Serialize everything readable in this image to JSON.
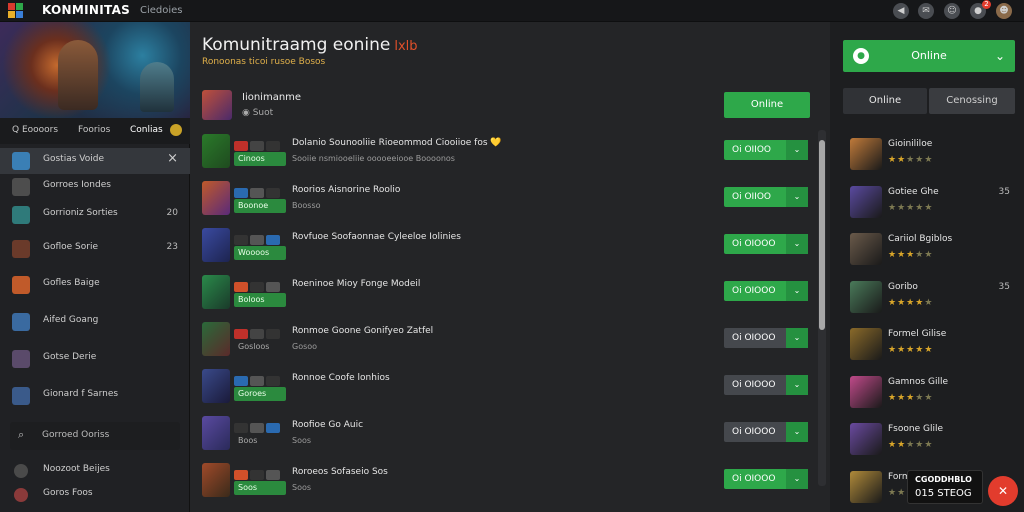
{
  "app": {
    "brand": "KONMINITAS",
    "top_nav": "Ciedoies",
    "top_icons": [
      "back-icon",
      "chat-icon",
      "smile-icon",
      "notification-icon",
      "profile-icon"
    ],
    "notification_count": "2"
  },
  "sidebar": {
    "tabs": [
      {
        "label": "Q Eoooors"
      },
      {
        "label": "Foorios"
      },
      {
        "label": "Conlias"
      }
    ],
    "items": [
      {
        "label": "Gostias Voide",
        "count": "",
        "color": "#3a7fb5",
        "active": true
      },
      {
        "label": "Gorroes Iondes",
        "count": "",
        "color": "#4d4d4d",
        "active": false
      },
      {
        "label": "Gorrioniz Sorties",
        "count": "20",
        "color": "#2f7a7a",
        "active": false
      },
      {
        "label": "Gofloe Sorie",
        "count": "23",
        "color": "#6a3a2a",
        "active": false
      },
      {
        "label": "Gofles Baige",
        "count": "",
        "color": "#c05a2a",
        "active": false
      },
      {
        "label": "Aifed Goang",
        "count": "",
        "color": "#3a6aa0",
        "active": false
      },
      {
        "label": "Gotse Derie",
        "count": "",
        "color": "#5a4a6a",
        "active": false
      },
      {
        "label": "Gionard f Sarnes",
        "count": "",
        "color": "#3a5a8a",
        "active": false
      },
      {
        "label": "Gorroed Ooriss",
        "count": "",
        "color": "#3a3a3a",
        "active": false
      },
      {
        "label": "Noozoot Beijes",
        "count": "",
        "color": "#4a4a4a",
        "active": false
      },
      {
        "label": "Goros Foos",
        "count": "",
        "color": "#8a3a3a",
        "active": false
      }
    ]
  },
  "main": {
    "title": "Komunitraamg eonine",
    "title_accent": "lxlb",
    "subtitle": "Ronoonas ticoi rusoe Bosos",
    "featured": {
      "name": "Iionimanme",
      "meta": "Suot",
      "button": "Online"
    },
    "rows": [
      {
        "title": "Dolanio Sounooliie Rioeommod Ciooiioe fos 💛",
        "meta": "Sooiie nsmiooeliie ooooeeiooe Boooonos",
        "tag": "Cinoos",
        "button": "Oi OIIOO",
        "state": "green"
      },
      {
        "title": "Roorios Aisnorine Roolio",
        "meta": "Boosso",
        "tag": "Boonoe",
        "button": "Oi OIIOO",
        "state": "green"
      },
      {
        "title": "Rovfuoe Soofaonnae Cyleeloe Iolinies",
        "meta": "",
        "tag": "Woooos",
        "button": "Oi OIOOO",
        "state": "green"
      },
      {
        "title": "Roeninoe Mioy Fonge Modeil",
        "meta": "",
        "tag": "Boloos",
        "button": "Oi OIOOO",
        "state": "green"
      },
      {
        "title": "Ronmoe Goone Gonifyeo Zatfel",
        "meta": "Gosoo",
        "tag": "Gosloos",
        "button": "Oi OIOOO",
        "state": "gray"
      },
      {
        "title": "Ronnoe Coofe lonhios",
        "meta": "",
        "tag": "Goroes",
        "button": "Oi OIOOO",
        "state": "gray"
      },
      {
        "title": "Roofioe Go Auic",
        "meta": "Soos",
        "tag": "Boos",
        "button": "Oi OIOOO",
        "state": "gray"
      },
      {
        "title": "Roroeos Sofaseio Sos",
        "meta": "Soos",
        "tag": "Soos",
        "button": "Oi OIOOO",
        "state": "green"
      }
    ]
  },
  "right_panel": {
    "button": "Online",
    "tabs": [
      "Online",
      "Cenossing"
    ],
    "friends": [
      {
        "name": "Gioinililoe",
        "count": "",
        "stars": 2,
        "color": "#c07a3a"
      },
      {
        "name": "Gotiee Ghe",
        "count": "35",
        "stars": 0,
        "color": "#5a4aa0"
      },
      {
        "name": "Cariiol Bgiblos",
        "count": "",
        "stars": 3,
        "color": "#6a5a4a"
      },
      {
        "name": "Goribo",
        "count": "35",
        "stars": 4,
        "color": "#4a7a5a"
      },
      {
        "name": "Formel Gilise",
        "count": "",
        "stars": 5,
        "color": "#8a6a2a"
      },
      {
        "name": "Gamnos Gille",
        "count": "",
        "stars": 3,
        "color": "#c04a8a"
      },
      {
        "name": "Fsoone Glile",
        "count": "",
        "stars": 2,
        "color": "#6a4aa0"
      },
      {
        "name": "Form",
        "count": "",
        "stars": 0,
        "color": "#b08a3a"
      }
    ]
  },
  "toast": {
    "line1": "CGODDHBLO",
    "line2": "015 STEOG"
  },
  "colors": {
    "accent_green": "#2ea84a",
    "accent_red": "#e23c2d",
    "background": "#1b1c1e"
  }
}
